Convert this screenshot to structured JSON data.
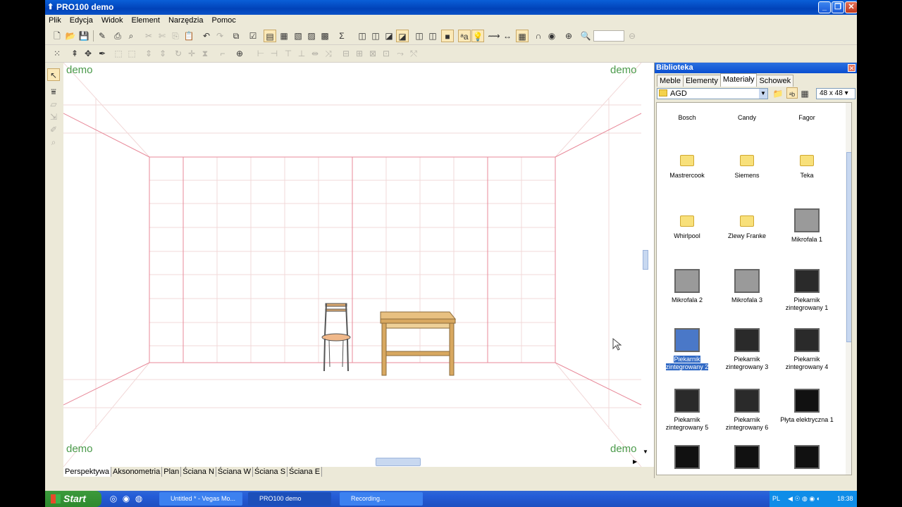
{
  "window": {
    "title": "PRO100 demo"
  },
  "menu": [
    "Plik",
    "Edycja",
    "Widok",
    "Element",
    "Narzędzia",
    "Pomoc"
  ],
  "viewport": {
    "watermark": "demo"
  },
  "view_tabs": [
    "Perspektywa",
    "Aksonometria",
    "Plan",
    "Ściana N",
    "Ściana W",
    "Ściana S",
    "Ściana E"
  ],
  "library": {
    "title": "Biblioteka",
    "tabs": [
      "Meble",
      "Elementy",
      "Materiały",
      "Schowek"
    ],
    "active_tab": "Materiały",
    "folder": "AGD",
    "icon_size": "48 x 48",
    "items": [
      {
        "label": "Bosch",
        "kind": "folder"
      },
      {
        "label": "Candy",
        "kind": "folder"
      },
      {
        "label": "Fagor",
        "kind": "folder"
      },
      {
        "label": "Mastrercook",
        "kind": "folder"
      },
      {
        "label": "Siemens",
        "kind": "folder"
      },
      {
        "label": "Teka",
        "kind": "folder"
      },
      {
        "label": "Whirlpool",
        "kind": "folder"
      },
      {
        "label": "Zlewy Franke",
        "kind": "folder"
      },
      {
        "label": "Mikrofala 1",
        "kind": "microwave"
      },
      {
        "label": "Mikrofala 2",
        "kind": "microwave"
      },
      {
        "label": "Mikrofala 3",
        "kind": "microwave"
      },
      {
        "label": "Piekarnik zintegrowany 1",
        "kind": "oven"
      },
      {
        "label": "Piekarnik zintegrowany 2",
        "kind": "oven",
        "selected": true
      },
      {
        "label": "Piekarnik zintegrowany 3",
        "kind": "oven"
      },
      {
        "label": "Piekarnik zintegrowany 4",
        "kind": "oven"
      },
      {
        "label": "Piekarnik zintegrowany 5",
        "kind": "oven"
      },
      {
        "label": "Piekarnik zintegrowany 6",
        "kind": "oven"
      },
      {
        "label": "Płyta elektryczna 1",
        "kind": "hob"
      },
      {
        "label": "",
        "kind": "hob"
      },
      {
        "label": "",
        "kind": "hob"
      },
      {
        "label": "",
        "kind": "hob"
      }
    ]
  },
  "taskbar": {
    "start": "Start",
    "tasks": [
      "Untitled * - Vegas Mo...",
      "PRO100 demo",
      "Recording..."
    ],
    "lang": "PL",
    "clock": "18:38"
  }
}
